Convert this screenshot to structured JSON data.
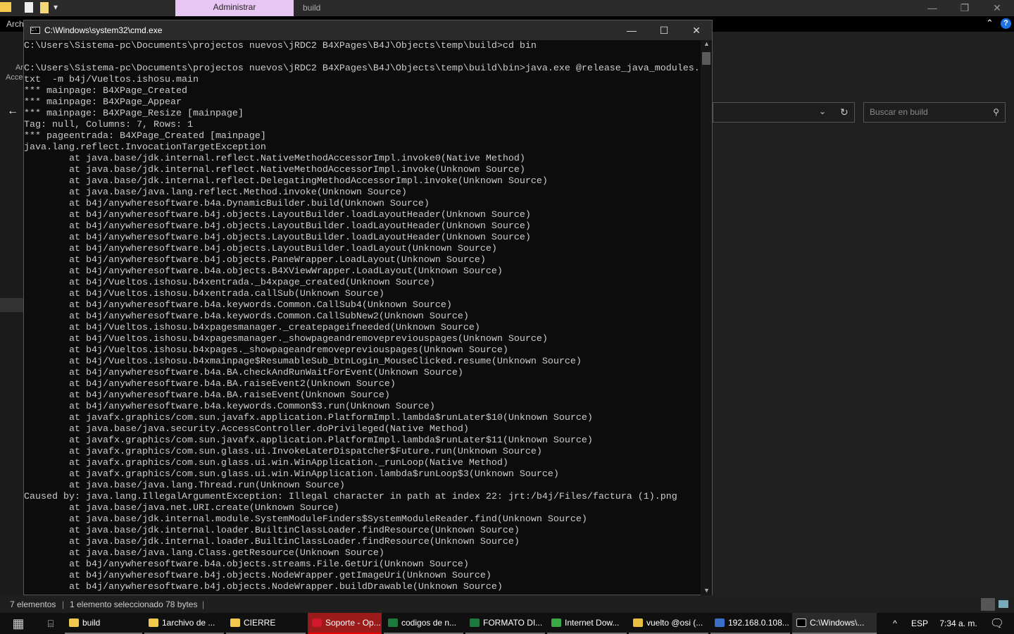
{
  "explorer": {
    "ribbon_tab_admin": "Administrar",
    "window_title": "build",
    "menu_archivo": "Arch",
    "side_text_1": "Ar",
    "side_text_2": "Acce",
    "search_placeholder": "Buscar en build"
  },
  "status": {
    "items_count": "7 elementos",
    "selected": "1 elemento seleccionado  78 bytes"
  },
  "cmd": {
    "title": "C:\\Windows\\system32\\cmd.exe",
    "lines": [
      "C:\\Users\\Sistema-pc\\Documents\\projectos nuevos\\jRDC2 B4XPages\\B4J\\Objects\\temp\\build>cd bin",
      "",
      "C:\\Users\\Sistema-pc\\Documents\\projectos nuevos\\jRDC2 B4XPages\\B4J\\Objects\\temp\\build\\bin>java.exe @release_java_modules.",
      "txt  -m b4j/Vueltos.ishosu.main",
      "*** mainpage: B4XPage_Created",
      "*** mainpage: B4XPage_Appear",
      "*** mainpage: B4XPage_Resize [mainpage]",
      "Tag: null, Columns: 7, Rows: 1",
      "*** pageentrada: B4XPage_Created [mainpage]",
      "java.lang.reflect.InvocationTargetException",
      "        at java.base/jdk.internal.reflect.NativeMethodAccessorImpl.invoke0(Native Method)",
      "        at java.base/jdk.internal.reflect.NativeMethodAccessorImpl.invoke(Unknown Source)",
      "        at java.base/jdk.internal.reflect.DelegatingMethodAccessorImpl.invoke(Unknown Source)",
      "        at java.base/java.lang.reflect.Method.invoke(Unknown Source)",
      "        at b4j/anywheresoftware.b4a.DynamicBuilder.build(Unknown Source)",
      "        at b4j/anywheresoftware.b4j.objects.LayoutBuilder.loadLayoutHeader(Unknown Source)",
      "        at b4j/anywheresoftware.b4j.objects.LayoutBuilder.loadLayoutHeader(Unknown Source)",
      "        at b4j/anywheresoftware.b4j.objects.LayoutBuilder.loadLayoutHeader(Unknown Source)",
      "        at b4j/anywheresoftware.b4j.objects.LayoutBuilder.loadLayout(Unknown Source)",
      "        at b4j/anywheresoftware.b4j.objects.PaneWrapper.LoadLayout(Unknown Source)",
      "        at b4j/anywheresoftware.b4a.objects.B4XViewWrapper.LoadLayout(Unknown Source)",
      "        at b4j/Vueltos.ishosu.b4xentrada._b4xpage_created(Unknown Source)",
      "        at b4j/Vueltos.ishosu.b4xentrada.callSub(Unknown Source)",
      "        at b4j/anywheresoftware.b4a.keywords.Common.CallSub4(Unknown Source)",
      "        at b4j/anywheresoftware.b4a.keywords.Common.CallSubNew2(Unknown Source)",
      "        at b4j/Vueltos.ishosu.b4xpagesmanager._createpageifneeded(Unknown Source)",
      "        at b4j/Vueltos.ishosu.b4xpagesmanager._showpageandremovepreviouspages(Unknown Source)",
      "        at b4j/Vueltos.ishosu.b4xpages._showpageandremovepreviouspages(Unknown Source)",
      "        at b4j/Vueltos.ishosu.b4xmainpage$ResumableSub_btnLogin_MouseClicked.resume(Unknown Source)",
      "        at b4j/anywheresoftware.b4a.BA.checkAndRunWaitForEvent(Unknown Source)",
      "        at b4j/anywheresoftware.b4a.BA.raiseEvent2(Unknown Source)",
      "        at b4j/anywheresoftware.b4a.BA.raiseEvent(Unknown Source)",
      "        at b4j/anywheresoftware.b4a.keywords.Common$3.run(Unknown Source)",
      "        at javafx.graphics/com.sun.javafx.application.PlatformImpl.lambda$runLater$10(Unknown Source)",
      "        at java.base/java.security.AccessController.doPrivileged(Native Method)",
      "        at javafx.graphics/com.sun.javafx.application.PlatformImpl.lambda$runLater$11(Unknown Source)",
      "        at javafx.graphics/com.sun.glass.ui.InvokeLaterDispatcher$Future.run(Unknown Source)",
      "        at javafx.graphics/com.sun.glass.ui.win.WinApplication._runLoop(Native Method)",
      "        at javafx.graphics/com.sun.glass.ui.win.WinApplication.lambda$runLoop$3(Unknown Source)",
      "        at java.base/java.lang.Thread.run(Unknown Source)",
      "Caused by: java.lang.IllegalArgumentException: Illegal character in path at index 22: jrt:/b4j/Files/factura (1).png",
      "        at java.base/java.net.URI.create(Unknown Source)",
      "        at java.base/jdk.internal.module.SystemModuleFinders$SystemModuleReader.find(Unknown Source)",
      "        at java.base/jdk.internal.loader.BuiltinClassLoader.findResource(Unknown Source)",
      "        at java.base/jdk.internal.loader.BuiltinClassLoader.findResource(Unknown Source)",
      "        at java.base/java.lang.Class.getResource(Unknown Source)",
      "        at b4j/anywheresoftware.b4a.objects.streams.File.GetUri(Unknown Source)",
      "        at b4j/anywheresoftware.b4j.objects.NodeWrapper.getImageUri(Unknown Source)",
      "        at b4j/anywheresoftware.b4j.objects.NodeWrapper.buildDrawable(Unknown Source)"
    ]
  },
  "taskbar": {
    "items": [
      {
        "label": "build",
        "color": "#f2c94c"
      },
      {
        "label": "1archivo de ...",
        "color": "#f2c94c"
      },
      {
        "label": "CIERRE",
        "color": "#f2c94c"
      },
      {
        "label": "Soporte - Op...",
        "color": "#d0182f"
      },
      {
        "label": "codigos de n...",
        "color": "#1d7a3e"
      },
      {
        "label": "FORMATO DI...",
        "color": "#1d7a3e"
      },
      {
        "label": "Internet Dow...",
        "color": "#3aa845"
      },
      {
        "label": "vuelto @osi (...",
        "color": "#e8c140"
      },
      {
        "label": "192.168.0.108...",
        "color": "#3c6fc9"
      },
      {
        "label": "C:\\Windows\\...",
        "color": "#000000"
      }
    ],
    "lang": "ESP",
    "time": "7:34 a. m."
  }
}
